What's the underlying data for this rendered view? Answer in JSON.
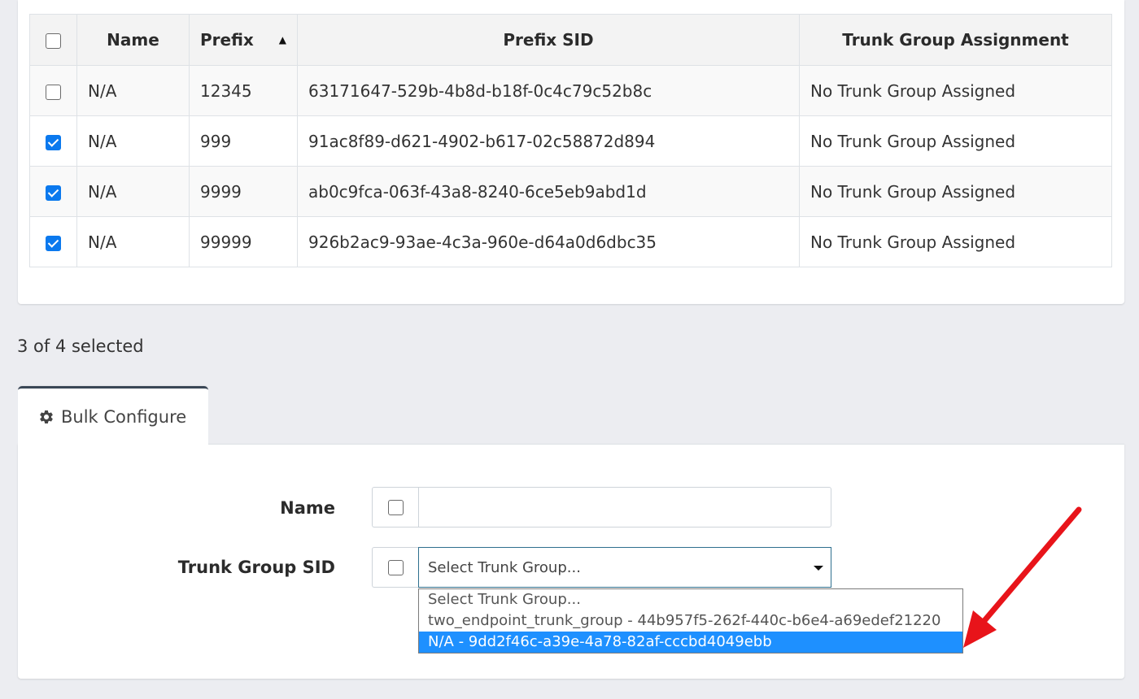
{
  "table": {
    "headers": {
      "name": "Name",
      "prefix": "Prefix",
      "prefix_sid": "Prefix SID",
      "trunk": "Trunk Group Assignment"
    },
    "rows": [
      {
        "checked": false,
        "name": "N/A",
        "prefix": "12345",
        "prefix_sid": "63171647-529b-4b8d-b18f-0c4c79c52b8c",
        "trunk": "No Trunk Group Assigned"
      },
      {
        "checked": true,
        "name": "N/A",
        "prefix": "999",
        "prefix_sid": "91ac8f89-d621-4902-b617-02c58872d894",
        "trunk": "No Trunk Group Assigned"
      },
      {
        "checked": true,
        "name": "N/A",
        "prefix": "9999",
        "prefix_sid": "ab0c9fca-063f-43a8-8240-6ce5eb9abd1d",
        "trunk": "No Trunk Group Assigned"
      },
      {
        "checked": true,
        "name": "N/A",
        "prefix": "99999",
        "prefix_sid": "926b2ac9-93ae-4c3a-960e-d64a0d6dbc35",
        "trunk": "No Trunk Group Assigned"
      }
    ],
    "sort": "ascending"
  },
  "status": {
    "selection": "3 of 4 selected"
  },
  "tab": {
    "label": "Bulk Configure",
    "icon": "gear-icon"
  },
  "form": {
    "name_label": "Name",
    "name_value": "",
    "trunk_label": "Trunk Group SID",
    "trunk_selected": "Select Trunk Group..."
  },
  "dropdown": {
    "options": [
      "Select Trunk Group...",
      "two_endpoint_trunk_group - 44b957f5-262f-440c-b6e4-a69edef21220",
      "N/A - 9dd2f46c-a39e-4a78-82af-cccbd4049ebb"
    ],
    "highlighted_index": 2
  },
  "colors": {
    "accent": "#0b79ee",
    "highlight": "#1e90ff",
    "annotation_arrow": "#e8141a",
    "tab_border": "#3a4756"
  }
}
